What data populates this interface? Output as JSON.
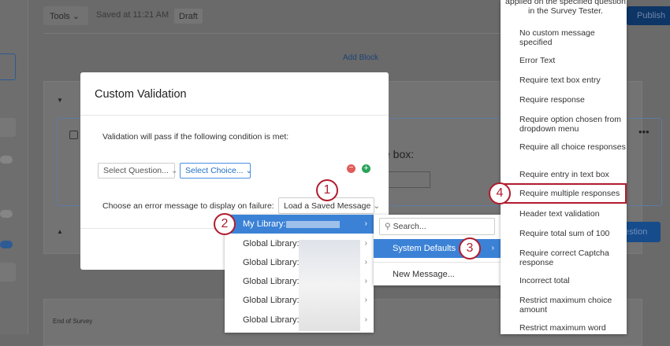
{
  "toolbar": {
    "tools_label": "Tools",
    "saved_text": "Saved at 11:21 AM",
    "draft_badge": "Draft",
    "publish_label": "Publish"
  },
  "editor": {
    "add_block": "Add Block",
    "question_fragment": "e box:",
    "add_question_fragment": "estion",
    "end_of_survey": "End of Survey"
  },
  "modal": {
    "title": "Custom Validation",
    "condition_text": "Validation will pass if the following condition is met:",
    "select_question": "Select Question...",
    "select_choice": "Select Choice...",
    "error_label": "Choose an error message to display on failure:",
    "load_button": "Load a Saved Message"
  },
  "library_menu": {
    "items": [
      {
        "label": "My Library:"
      },
      {
        "label": "Global Library:"
      },
      {
        "label": "Global Library:"
      },
      {
        "label": "Global Library:"
      },
      {
        "label": "Global Library:"
      },
      {
        "label": "Global Library:"
      }
    ]
  },
  "submenu": {
    "search_placeholder": "Search...",
    "system_defaults": "System Defaults",
    "new_message": "New Message..."
  },
  "messages": {
    "partial_top": "applied on the specified question in the Survey Tester.",
    "items": [
      "No custom message specified",
      "Error Text",
      "Require text box entry",
      "Require response",
      "Require option chosen from dropdown menu",
      "Require all choice responses",
      "Require entry in text box",
      "Require multiple responses",
      "Header text validation",
      "Require total sum of 100",
      "Require correct Captcha response",
      "Incorrect total",
      "Restrict maximum choice amount",
      "Restrict maximum word"
    ]
  },
  "steps": [
    "1",
    "2",
    "3",
    "4"
  ],
  "colors": {
    "accent": "#3b82d6",
    "callout": "#b01c2e",
    "publish": "#0b3f7a"
  }
}
